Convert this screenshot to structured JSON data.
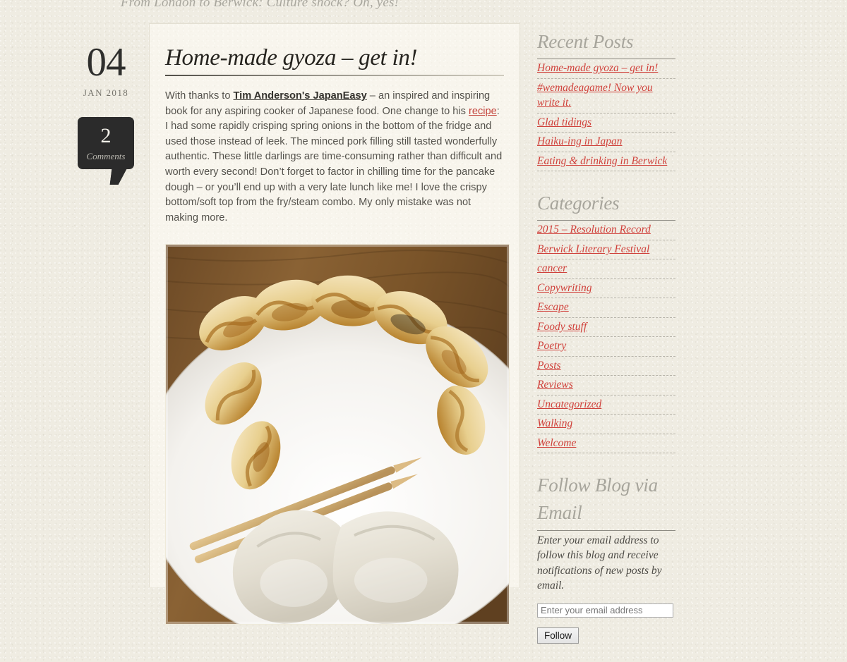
{
  "site": {
    "tagline": "From London to Berwick: Culture shock? Oh, yes!"
  },
  "post": {
    "date": {
      "day": "04",
      "month_year": "JAN 2018"
    },
    "comments": {
      "count": "2",
      "label": "Comments"
    },
    "title": "Home-made gyoza – get in!",
    "body": {
      "part1": "With thanks to ",
      "link_book": "Tim Anderson's JapanEasy",
      "part2": " – an inspired and inspiring book for any aspiring cooker of Japanese food. One change to his ",
      "link_recipe": "recipe",
      "part3": ": I had some rapidly crisping spring onions in the bottom of the fridge and used those instead of leek. The minced pork filling still tasted wonderfully authentic. These little darlings are time-consuming rather than difficult and worth every second! Don’t forget to factor in chilling time for the pancake dough – or you’ll end up with a very late lunch like me! I love the crispy bottom/soft top from the fry/steam combo. My only mistake was not making more."
    },
    "image_alt": "Plate of home-made gyoza dumplings with wooden chopsticks"
  },
  "sidebar": {
    "recent_posts": {
      "title": "Recent Posts",
      "items": [
        "Home-made gyoza – get in!",
        "#wemadeagame! Now you write it.",
        "Glad tidings",
        "Haiku-ing in Japan",
        "Eating & drinking in Berwick"
      ]
    },
    "categories": {
      "title": "Categories",
      "items": [
        "2015 – Resolution Record",
        "Berwick Literary Festival",
        "cancer",
        "Copywriting",
        "Escape",
        "Foody stuff",
        "Poetry",
        "Posts",
        "Reviews",
        "Uncategorized",
        "Walking",
        "Welcome"
      ]
    },
    "follow": {
      "title": "Follow Blog via Email",
      "description": "Enter your email address to follow this blog and receive notifications of new posts by email.",
      "input_placeholder": "Enter your email address",
      "input_value": "",
      "button_label": "Follow"
    }
  },
  "colors": {
    "page_background": "#efece2",
    "link_red": "#d0413b",
    "heading_gray": "#a7a59c",
    "bubble_dark": "#2b2b2b",
    "body_text": "#55534d"
  }
}
